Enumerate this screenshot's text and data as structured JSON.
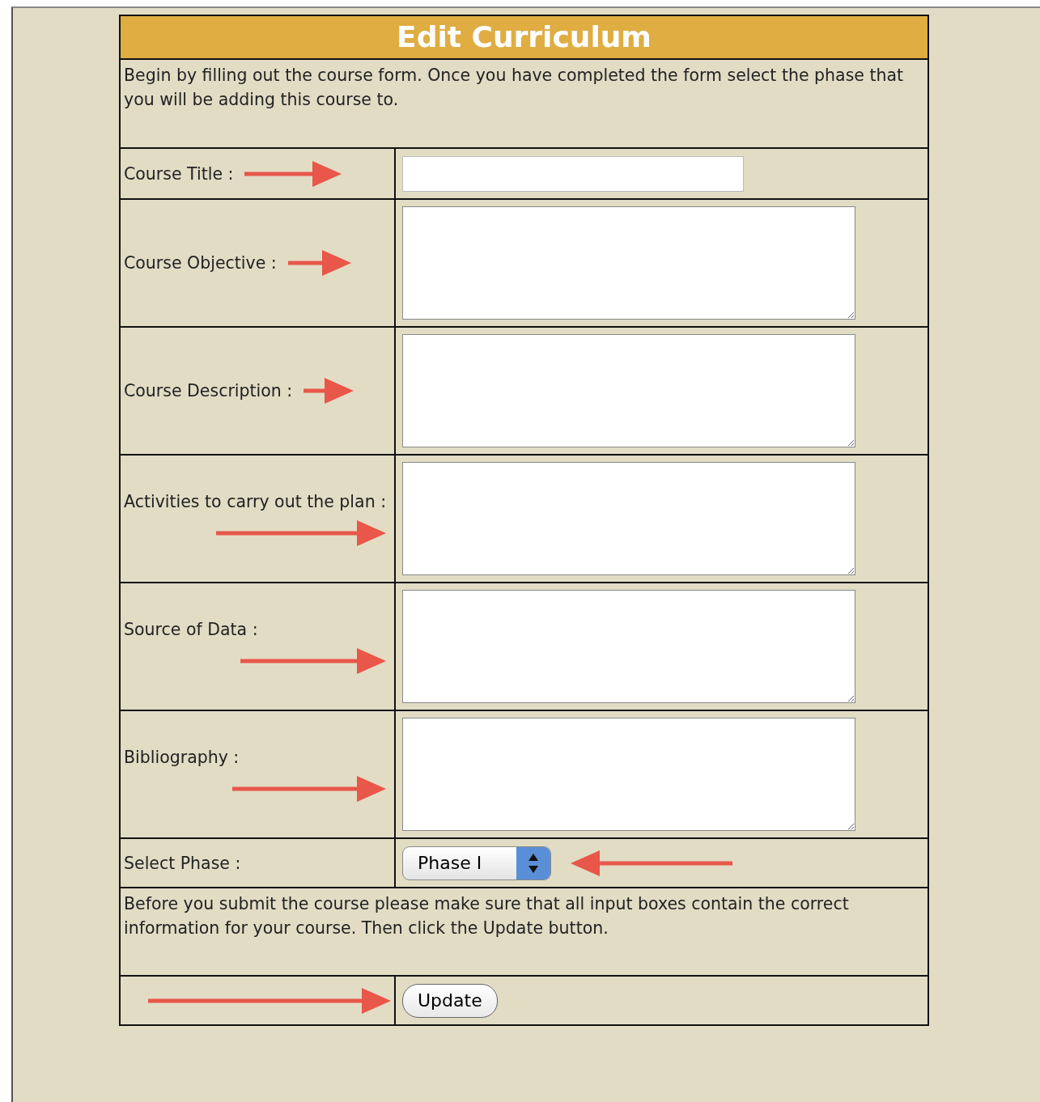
{
  "title": "Edit Curriculum",
  "intro": "Begin by filling out the course form. Once you have completed the form select the phase that you will be adding this course to.",
  "fields": [
    {
      "label": "Course Title :",
      "kind": "text"
    },
    {
      "label": "Course Objective :",
      "kind": "textarea"
    },
    {
      "label": "Course Description :",
      "kind": "textarea"
    },
    {
      "label": "Activities to carry out the plan :",
      "kind": "textarea"
    },
    {
      "label": "Source of Data :",
      "kind": "textarea"
    },
    {
      "label": "Bibliography :",
      "kind": "textarea"
    }
  ],
  "phase": {
    "label": "Select Phase :",
    "value": "Phase I"
  },
  "note": "Before you submit the course please make sure that all input boxes contain the correct information for your course. Then click the Update button.",
  "button": "Update"
}
